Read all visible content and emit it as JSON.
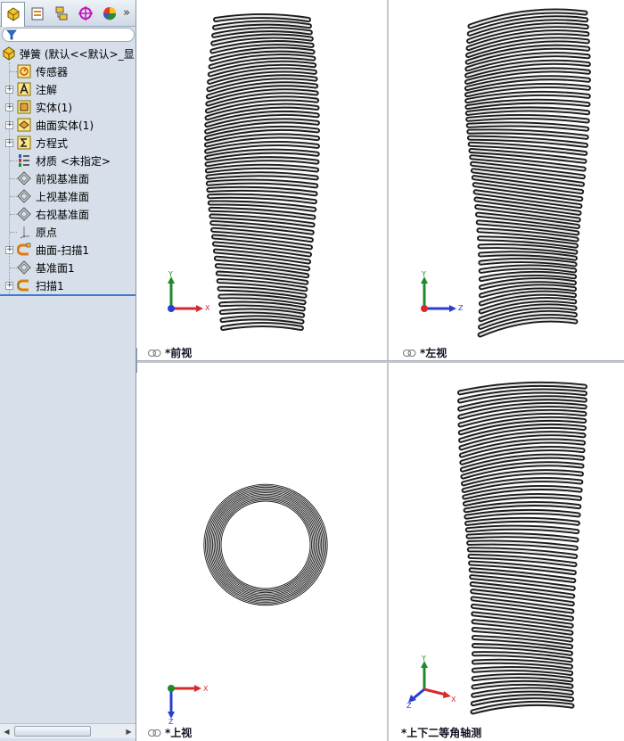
{
  "feature_tree": {
    "root_label": "弹簧 (默认<<默认>_显",
    "items": [
      {
        "label": "传感器",
        "icon": "sensor-icon",
        "expandable": false
      },
      {
        "label": "注解",
        "icon": "annotation-icon",
        "expandable": true
      },
      {
        "label": "实体(1)",
        "icon": "solid-body-icon",
        "expandable": true
      },
      {
        "label": "曲面实体(1)",
        "icon": "surface-body-icon",
        "expandable": true
      },
      {
        "label": "方程式",
        "icon": "equation-icon",
        "expandable": true
      },
      {
        "label": "材质 <未指定>",
        "icon": "material-icon",
        "expandable": false
      },
      {
        "label": "前视基准面",
        "icon": "plane-icon",
        "expandable": false
      },
      {
        "label": "上视基准面",
        "icon": "plane-icon",
        "expandable": false
      },
      {
        "label": "右视基准面",
        "icon": "plane-icon",
        "expandable": false
      },
      {
        "label": "原点",
        "icon": "origin-icon",
        "expandable": false
      },
      {
        "label": "曲面-扫描1",
        "icon": "surface-sweep-icon",
        "expandable": true
      },
      {
        "label": "基准面1",
        "icon": "plane-icon",
        "expandable": false
      },
      {
        "label": "扫描1",
        "icon": "sweep-icon",
        "expandable": true
      }
    ]
  },
  "panel_tabs": {
    "more_label": "»"
  },
  "viewports": {
    "front": {
      "label": "*前视"
    },
    "left": {
      "label": "*左视"
    },
    "top": {
      "label": "*上视"
    },
    "iso": {
      "label": "*上下二等角轴测"
    }
  },
  "triad": {
    "front": {
      "h": "X",
      "v": "Y"
    },
    "left": {
      "h": "Z",
      "v": "Y"
    },
    "top": {
      "h": "X",
      "v": "Z"
    },
    "iso": {
      "h": "X",
      "v": "Y",
      "d": "Z"
    }
  },
  "colors": {
    "panel_bg": "#d6dfea",
    "axis_x": "#d42b2b",
    "axis_y": "#1f8a2a",
    "axis_z": "#2a3fd0",
    "spring_dark": "#1a1a1a",
    "spring_light": "#e8e8e8"
  }
}
